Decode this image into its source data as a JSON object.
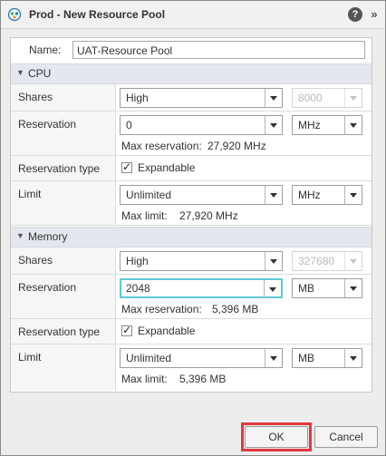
{
  "dialog": {
    "title": "Prod - New Resource Pool",
    "help_symbol": "?",
    "forward_symbol": "»",
    "icon": "resource-pool-icon"
  },
  "name_field": {
    "label": "Name:",
    "value": "UAT-Resource Pool"
  },
  "cpu": {
    "section_title": "CPU",
    "shares_label": "Shares",
    "shares_value": "High",
    "shares_number": "8000",
    "reservation_label": "Reservation",
    "reservation_value": "0",
    "reservation_unit": "MHz",
    "max_reservation_label": "Max reservation:",
    "max_reservation_value": "27,920 MHz",
    "reservation_type_label": "Reservation type",
    "expandable_label": "Expandable",
    "expandable_checked": true,
    "limit_label": "Limit",
    "limit_value": "Unlimited",
    "limit_unit": "MHz",
    "max_limit_label": "Max limit:",
    "max_limit_value": "27,920 MHz"
  },
  "memory": {
    "section_title": "Memory",
    "shares_label": "Shares",
    "shares_value": "High",
    "shares_number": "327680",
    "reservation_label": "Reservation",
    "reservation_value": "2048",
    "reservation_unit": "MB",
    "max_reservation_label": "Max reservation:",
    "max_reservation_value": "5,396 MB",
    "reservation_type_label": "Reservation type",
    "expandable_label": "Expandable",
    "expandable_checked": true,
    "limit_label": "Limit",
    "limit_value": "Unlimited",
    "limit_unit": "MB",
    "max_limit_label": "Max limit:",
    "max_limit_value": "5,396 MB"
  },
  "footer": {
    "ok_label": "OK",
    "cancel_label": "Cancel"
  },
  "colors": {
    "highlight": "#e0393e",
    "focus": "#5ec9d4",
    "section_bg": "#e4e7ee"
  }
}
